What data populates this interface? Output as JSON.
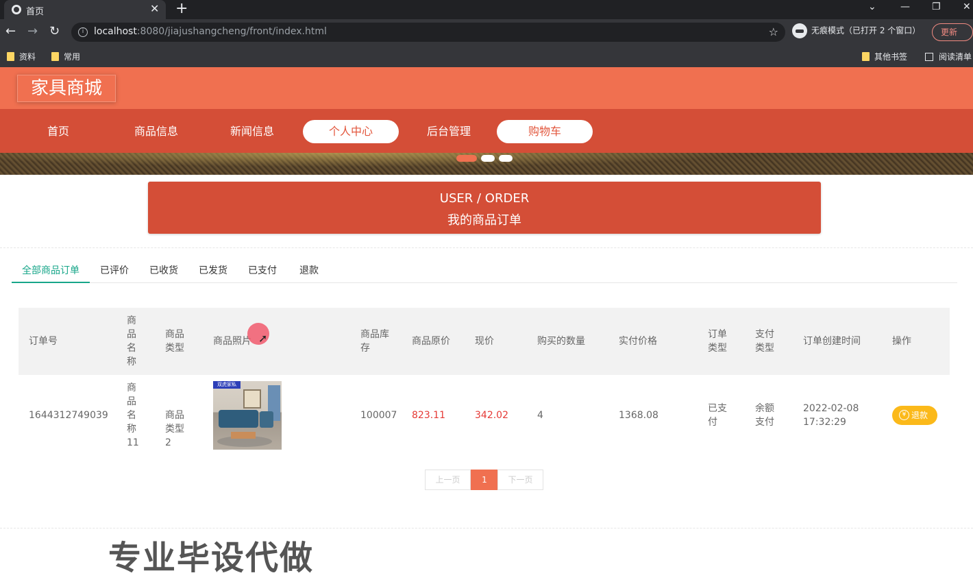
{
  "browser": {
    "tab_title": "首页",
    "tab_close": "✕",
    "new_tab": "+",
    "url_host": "localhost",
    "url_rest": ":8080/jiajushangcheng/front/index.html",
    "incognito_label": "无痕模式（已打开 2 个窗口）",
    "update_label": "更新",
    "bookmarks": [
      "资料",
      "常用"
    ],
    "other_bookmarks": "其他书签",
    "reading_list": "阅读清单"
  },
  "site": {
    "logo": "家具商城",
    "nav": [
      "首页",
      "商品信息",
      "新闻信息",
      "个人中心",
      "后台管理",
      "购物车"
    ],
    "section_en": "USER / ORDER",
    "section_zh": "我的商品订单"
  },
  "order_tabs": [
    "全部商品订单",
    "已评价",
    "已收货",
    "已发货",
    "已支付",
    "退款"
  ],
  "table": {
    "headers": {
      "order_no": "订单号",
      "product_name": "商品名称",
      "product_type": "商品类型",
      "product_photo": "商品照片",
      "stock": "商品库存",
      "orig_price": "商品原价",
      "cur_price": "现价",
      "qty": "购买的数量",
      "paid": "实付价格",
      "order_type": "订单类型",
      "pay_type": "支付类型",
      "created": "订单创建时间",
      "action": "操作"
    },
    "rows": [
      {
        "order_no": "1644312749039",
        "product_name": "商品名称11",
        "product_type": "商品类型2",
        "photo_tag": "双虎家私",
        "stock": "100007",
        "orig_price": "823.11",
        "cur_price": "342.02",
        "qty": "4",
        "paid": "1368.08",
        "order_type": "已支付",
        "pay_type": "余额支付",
        "created_date": "2022-02-08",
        "created_time": "17:32:29",
        "action": "退款"
      }
    ]
  },
  "pager": {
    "prev": "上一页",
    "current": "1",
    "next": "下一页"
  },
  "watermark": "专业毕设代做",
  "colors": {
    "header": "#f07050",
    "nav": "#d44e37",
    "tab_active": "#17a689",
    "price_red": "#e53935",
    "refund": "#fbb91a"
  }
}
